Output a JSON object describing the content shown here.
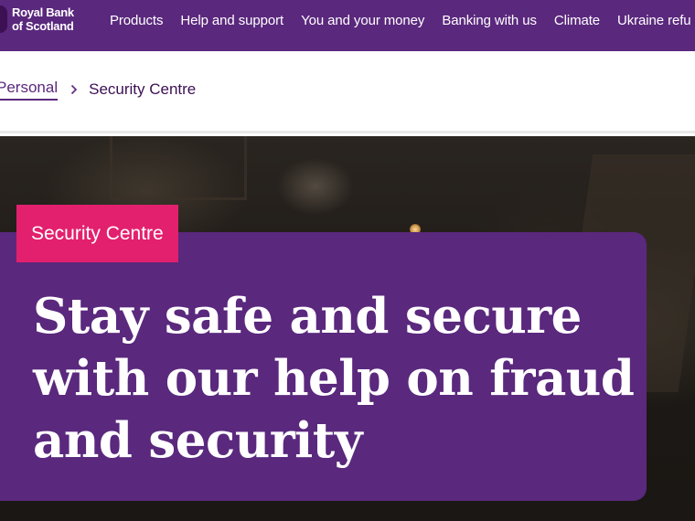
{
  "brand": {
    "line1": "Royal Bank",
    "line2": "of Scotland"
  },
  "nav": {
    "items": [
      "Products",
      "Help and support",
      "You and your money",
      "Banking with us",
      "Climate",
      "Ukraine refu"
    ]
  },
  "breadcrumb": {
    "parent": "Personal",
    "separator": "›",
    "current": "Security Centre"
  },
  "hero": {
    "tag": "Security Centre",
    "title": "Stay safe and secure with our help on fraud and security"
  },
  "colors": {
    "brand_purple": "#5a287d",
    "tag_pink": "#e3206e",
    "text_white": "#ffffff"
  },
  "icons": {
    "logo": "rbs-logo-icon",
    "breadcrumb_separator": "chevron-right-icon"
  }
}
